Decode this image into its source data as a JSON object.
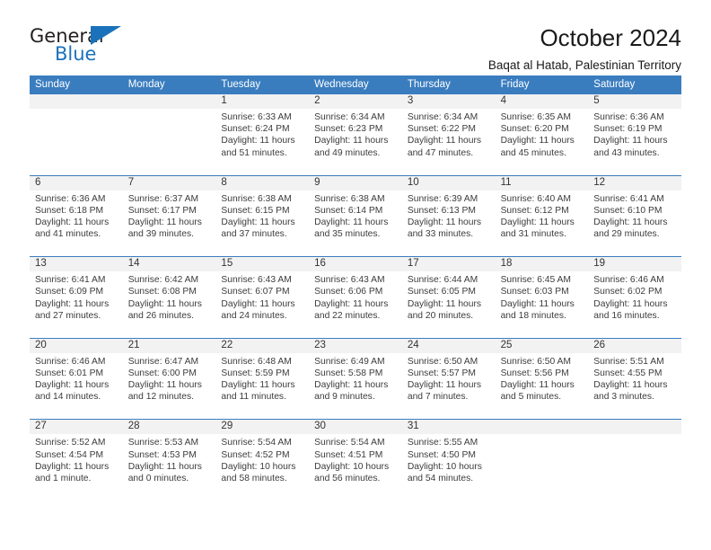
{
  "logo": {
    "word_top": "General",
    "word_bottom": "Blue",
    "accent_color": "#1b72bb"
  },
  "header": {
    "title": "October 2024",
    "subtitle": "Baqat al Hatab, Palestinian Territory",
    "header_bg": "#3a7dbf",
    "header_text": "#ffffff"
  },
  "calendar": {
    "weekdays": [
      "Sunday",
      "Monday",
      "Tuesday",
      "Wednesday",
      "Thursday",
      "Friday",
      "Saturday"
    ],
    "weeks": [
      [
        {
          "day": "",
          "info": ""
        },
        {
          "day": "",
          "info": ""
        },
        {
          "day": "1",
          "info": "Sunrise: 6:33 AM\nSunset: 6:24 PM\nDaylight: 11 hours and 51 minutes."
        },
        {
          "day": "2",
          "info": "Sunrise: 6:34 AM\nSunset: 6:23 PM\nDaylight: 11 hours and 49 minutes."
        },
        {
          "day": "3",
          "info": "Sunrise: 6:34 AM\nSunset: 6:22 PM\nDaylight: 11 hours and 47 minutes."
        },
        {
          "day": "4",
          "info": "Sunrise: 6:35 AM\nSunset: 6:20 PM\nDaylight: 11 hours and 45 minutes."
        },
        {
          "day": "5",
          "info": "Sunrise: 6:36 AM\nSunset: 6:19 PM\nDaylight: 11 hours and 43 minutes."
        }
      ],
      [
        {
          "day": "6",
          "info": "Sunrise: 6:36 AM\nSunset: 6:18 PM\nDaylight: 11 hours and 41 minutes."
        },
        {
          "day": "7",
          "info": "Sunrise: 6:37 AM\nSunset: 6:17 PM\nDaylight: 11 hours and 39 minutes."
        },
        {
          "day": "8",
          "info": "Sunrise: 6:38 AM\nSunset: 6:15 PM\nDaylight: 11 hours and 37 minutes."
        },
        {
          "day": "9",
          "info": "Sunrise: 6:38 AM\nSunset: 6:14 PM\nDaylight: 11 hours and 35 minutes."
        },
        {
          "day": "10",
          "info": "Sunrise: 6:39 AM\nSunset: 6:13 PM\nDaylight: 11 hours and 33 minutes."
        },
        {
          "day": "11",
          "info": "Sunrise: 6:40 AM\nSunset: 6:12 PM\nDaylight: 11 hours and 31 minutes."
        },
        {
          "day": "12",
          "info": "Sunrise: 6:41 AM\nSunset: 6:10 PM\nDaylight: 11 hours and 29 minutes."
        }
      ],
      [
        {
          "day": "13",
          "info": "Sunrise: 6:41 AM\nSunset: 6:09 PM\nDaylight: 11 hours and 27 minutes."
        },
        {
          "day": "14",
          "info": "Sunrise: 6:42 AM\nSunset: 6:08 PM\nDaylight: 11 hours and 26 minutes."
        },
        {
          "day": "15",
          "info": "Sunrise: 6:43 AM\nSunset: 6:07 PM\nDaylight: 11 hours and 24 minutes."
        },
        {
          "day": "16",
          "info": "Sunrise: 6:43 AM\nSunset: 6:06 PM\nDaylight: 11 hours and 22 minutes."
        },
        {
          "day": "17",
          "info": "Sunrise: 6:44 AM\nSunset: 6:05 PM\nDaylight: 11 hours and 20 minutes."
        },
        {
          "day": "18",
          "info": "Sunrise: 6:45 AM\nSunset: 6:03 PM\nDaylight: 11 hours and 18 minutes."
        },
        {
          "day": "19",
          "info": "Sunrise: 6:46 AM\nSunset: 6:02 PM\nDaylight: 11 hours and 16 minutes."
        }
      ],
      [
        {
          "day": "20",
          "info": "Sunrise: 6:46 AM\nSunset: 6:01 PM\nDaylight: 11 hours and 14 minutes."
        },
        {
          "day": "21",
          "info": "Sunrise: 6:47 AM\nSunset: 6:00 PM\nDaylight: 11 hours and 12 minutes."
        },
        {
          "day": "22",
          "info": "Sunrise: 6:48 AM\nSunset: 5:59 PM\nDaylight: 11 hours and 11 minutes."
        },
        {
          "day": "23",
          "info": "Sunrise: 6:49 AM\nSunset: 5:58 PM\nDaylight: 11 hours and 9 minutes."
        },
        {
          "day": "24",
          "info": "Sunrise: 6:50 AM\nSunset: 5:57 PM\nDaylight: 11 hours and 7 minutes."
        },
        {
          "day": "25",
          "info": "Sunrise: 6:50 AM\nSunset: 5:56 PM\nDaylight: 11 hours and 5 minutes."
        },
        {
          "day": "26",
          "info": "Sunrise: 5:51 AM\nSunset: 4:55 PM\nDaylight: 11 hours and 3 minutes."
        }
      ],
      [
        {
          "day": "27",
          "info": "Sunrise: 5:52 AM\nSunset: 4:54 PM\nDaylight: 11 hours and 1 minute."
        },
        {
          "day": "28",
          "info": "Sunrise: 5:53 AM\nSunset: 4:53 PM\nDaylight: 11 hours and 0 minutes."
        },
        {
          "day": "29",
          "info": "Sunrise: 5:54 AM\nSunset: 4:52 PM\nDaylight: 10 hours and 58 minutes."
        },
        {
          "day": "30",
          "info": "Sunrise: 5:54 AM\nSunset: 4:51 PM\nDaylight: 10 hours and 56 minutes."
        },
        {
          "day": "31",
          "info": "Sunrise: 5:55 AM\nSunset: 4:50 PM\nDaylight: 10 hours and 54 minutes."
        },
        {
          "day": "",
          "info": ""
        },
        {
          "day": "",
          "info": ""
        }
      ]
    ]
  }
}
